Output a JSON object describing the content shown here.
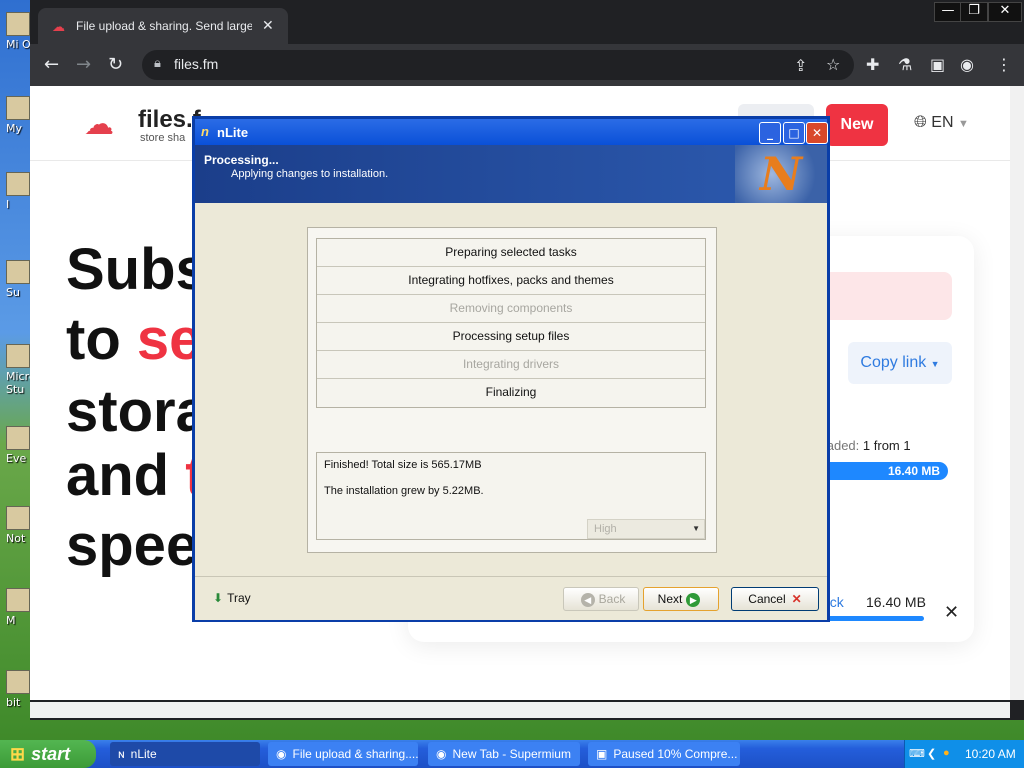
{
  "browser": {
    "tab_title": "File upload & sharing. Send large ph",
    "tab_close": "✕",
    "url": "files.fm",
    "window_buttons": [
      "—",
      "❐",
      "✕"
    ]
  },
  "page": {
    "logo_name": "files.f",
    "logo_tag": "store sha",
    "new_button": "New",
    "language": "EN",
    "hero_lines": [
      "Subs",
      "to",
      "se",
      "stora",
      "and",
      "t",
      "spee"
    ],
    "copy_link": "Copy link",
    "uploaded_label": "Uploaded:",
    "uploaded_value": "1 from 1",
    "progress_size": "16.40 MB",
    "back_link": "ack",
    "file_size": "16.40 MB",
    "close_x": "✕"
  },
  "dialog": {
    "title": "nLite",
    "header_title": "Processing...",
    "header_subtitle": "Applying changes to installation.",
    "tasks": [
      {
        "label": "Preparing selected tasks",
        "enabled": true
      },
      {
        "label": "Integrating hotfixes, packs and themes",
        "enabled": true
      },
      {
        "label": "Removing components",
        "enabled": false
      },
      {
        "label": "Processing setup files",
        "enabled": true
      },
      {
        "label": "Integrating drivers",
        "enabled": false
      },
      {
        "label": "Finalizing",
        "enabled": true
      }
    ],
    "result_line1": "Finished! Total size is 565.17MB",
    "result_line2": "The installation grew by 5.22MB.",
    "priority_value": "High",
    "tray_label": "Tray",
    "back_button": "Back",
    "next_button": "Next",
    "cancel_button": "Cancel"
  },
  "taskbar": {
    "start_label": "start",
    "items": [
      {
        "label": "nLite",
        "active": true
      },
      {
        "label": "File upload & sharing....",
        "active": false
      },
      {
        "label": "New Tab - Supermium",
        "active": false
      },
      {
        "label": "Paused 10% Compre...",
        "active": false
      }
    ],
    "clock": "10:20 AM"
  },
  "desktop_icons": [
    "Mi O",
    "My",
    "I",
    "Su",
    "Micro Stu",
    "Eve",
    "Not",
    "M",
    "bit"
  ],
  "colors": {
    "accent_red": "#ef3342",
    "link_blue": "#2f7be0",
    "xp_blue": "#0a50d8",
    "xp_start_green": "#3c9b37"
  }
}
